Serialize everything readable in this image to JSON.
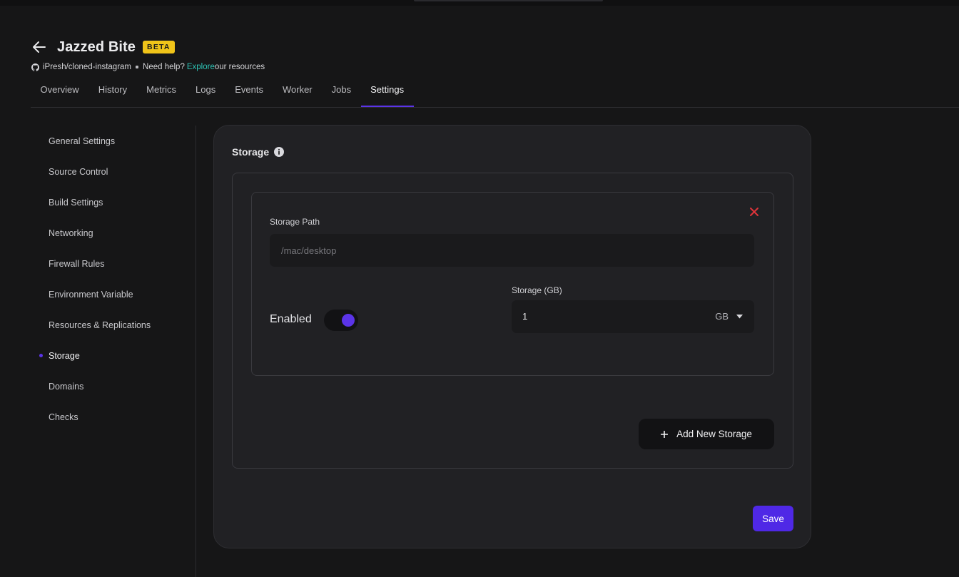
{
  "app": {
    "title": "Jazzed Bite",
    "badge": "BETA",
    "repo": "iPresh/cloned-instagram",
    "help_text": "Need help?",
    "explore_link": "Explore",
    "resources_text": "our resources"
  },
  "tabs": [
    {
      "label": "Overview"
    },
    {
      "label": "History"
    },
    {
      "label": "Metrics"
    },
    {
      "label": "Logs"
    },
    {
      "label": "Events"
    },
    {
      "label": "Worker"
    },
    {
      "label": "Jobs"
    },
    {
      "label": "Settings",
      "active": true
    }
  ],
  "sidebar": {
    "items": [
      {
        "label": "General Settings"
      },
      {
        "label": "Source Control"
      },
      {
        "label": "Build Settings"
      },
      {
        "label": "Networking"
      },
      {
        "label": "Firewall Rules"
      },
      {
        "label": "Environment Variable"
      },
      {
        "label": "Resources & Replications"
      },
      {
        "label": "Storage",
        "active": true
      },
      {
        "label": "Domains"
      },
      {
        "label": "Checks"
      }
    ]
  },
  "storage": {
    "title": "Storage",
    "path_label": "Storage Path",
    "path_placeholder": "/mac/desktop",
    "path_value": "",
    "enabled_label": "Enabled",
    "enabled": true,
    "size_label": "Storage (GB)",
    "size_value": "1",
    "size_unit": "GB",
    "add_button": "Add New Storage",
    "save_button": "Save"
  },
  "colors": {
    "accent": "#5b34e8",
    "badge": "#f0c419",
    "link": "#2ec4b6",
    "danger": "#e0343a",
    "background": "#161617",
    "panel": "#212124"
  }
}
